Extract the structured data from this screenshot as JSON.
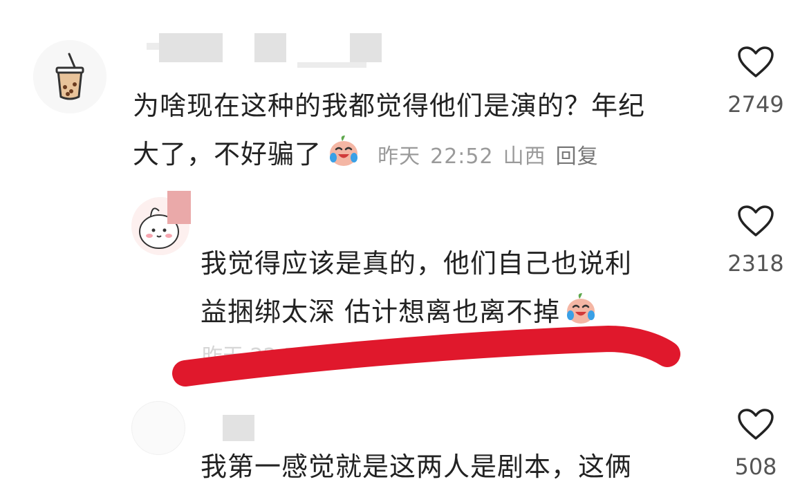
{
  "comments": [
    {
      "text_line1": "为啥现在这种的我都觉得他们是演的？年纪",
      "text_line2": "大了，不好骗了",
      "date": "昨天",
      "time": "22:52",
      "location": "山西",
      "reply_label": "回复",
      "likes": "2749",
      "emoji": "crying-laughing-peach"
    },
    {
      "text_line1": "我觉得应该是真的，他们自己也说利",
      "text_line2": "益捆绑太深  估计想离也离不掉",
      "meta_partial": "昨天 22:54 安徽",
      "likes": "2318",
      "emoji": "crying-laughing-peach"
    },
    {
      "text_line1": "我第一感觉就是这两人是剧本，这俩",
      "likes": "508"
    }
  ],
  "colors": {
    "text": "#222222",
    "meta": "#9a9a9a",
    "redline": "#e0182c"
  },
  "icons": [
    "heart-outline-icon",
    "bubble-tea-avatar",
    "pink-bunny-avatar",
    "crying-laughing-emoji"
  ]
}
